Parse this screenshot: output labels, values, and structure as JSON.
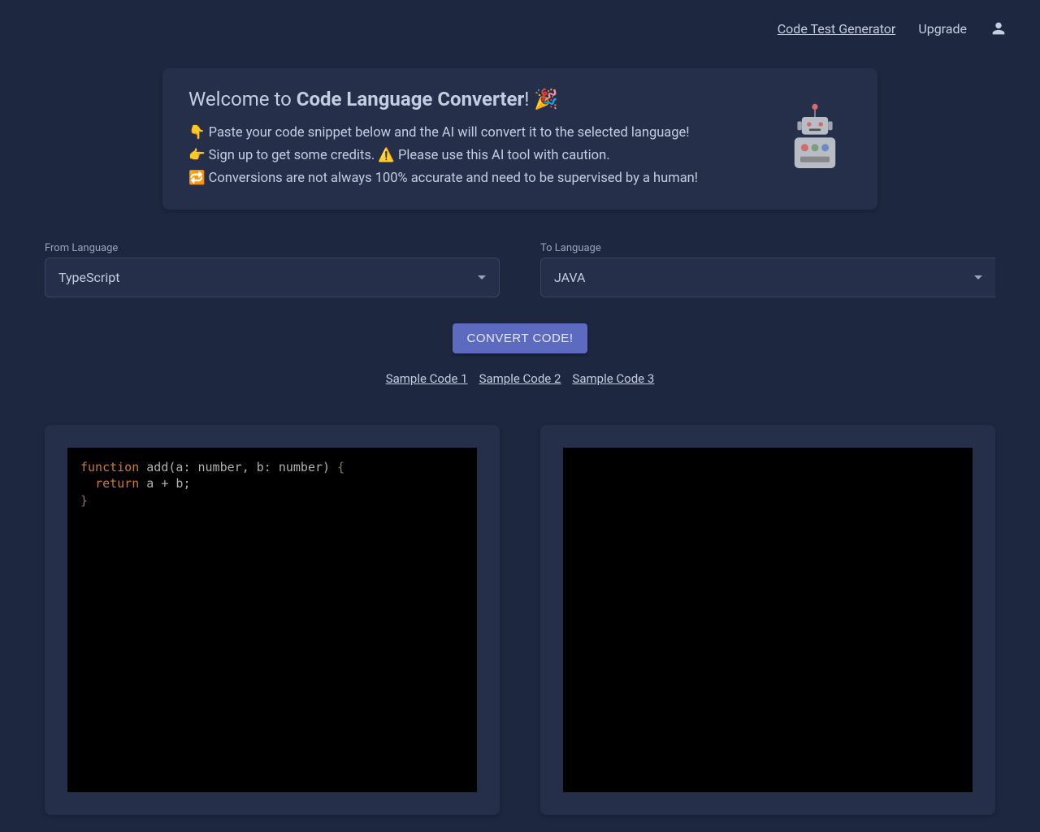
{
  "header": {
    "code_test_generator": "Code Test Generator",
    "upgrade": "Upgrade"
  },
  "welcome": {
    "prefix": "Welcome to ",
    "title_bold": "Code Language Converter",
    "suffix": "! 🎉",
    "line1": "👇 Paste your code snippet below and the AI will convert it to the selected language!",
    "line2": "👉 Sign up to get some credits. ⚠️ Please use this AI tool with caution.",
    "line3": "🔁 Conversions are not always 100% accurate and need to be supervised by a human!"
  },
  "from": {
    "label": "From Language",
    "value": "TypeScript"
  },
  "to": {
    "label": "To Language",
    "value": "JAVA"
  },
  "convert_label": "CONVERT CODE!",
  "samples": {
    "s1": "Sample Code 1",
    "s2": "Sample Code 2",
    "s3": "Sample Code 3"
  },
  "input_code": {
    "kw_function": "function",
    "fn_name": " add",
    "params_open": "(a",
    "colon1": ":",
    "type1": " number",
    "comma": ",",
    "param2": " b",
    "colon2": ":",
    "type2": " number",
    "params_close": ")",
    "space_brace": " ",
    "brace_open": "{",
    "indent": "  ",
    "kw_return": "return",
    "ret_expr_a": " a ",
    "plus": "+",
    "ret_expr_b": " b",
    "semicolon": ";",
    "brace_close": "}"
  },
  "output_code": ""
}
